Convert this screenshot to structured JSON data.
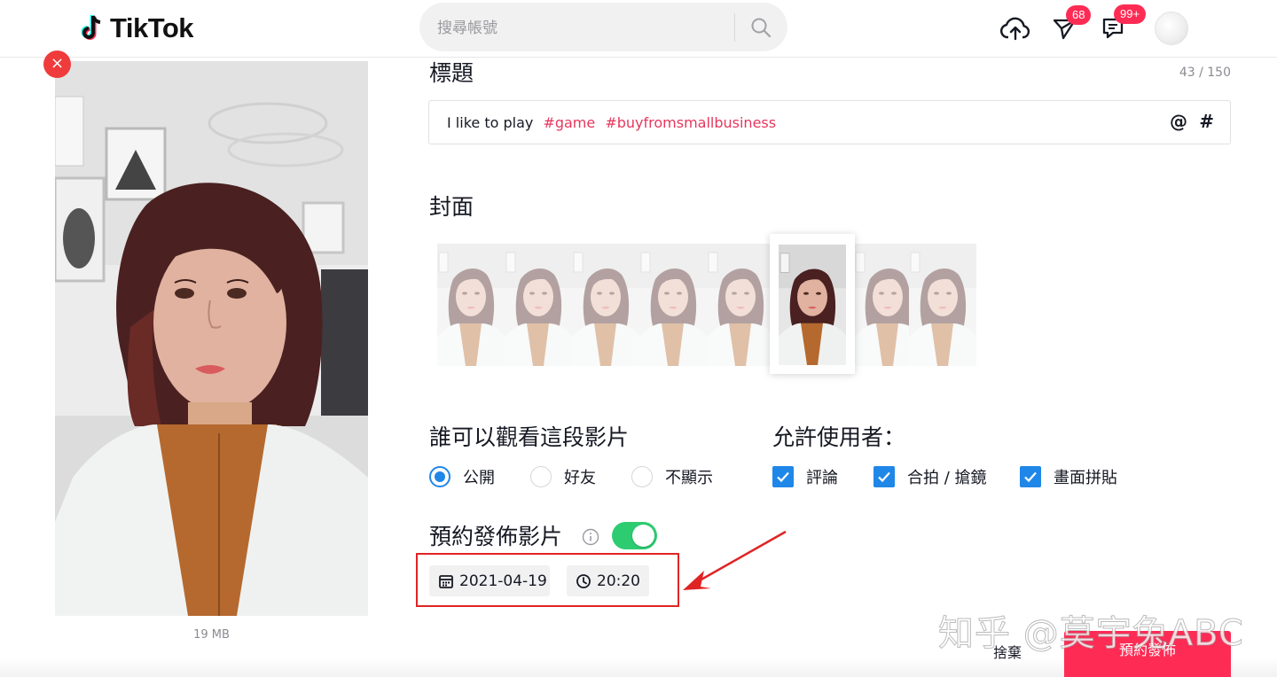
{
  "header": {
    "logo_text": "TikTok",
    "search_placeholder": "搜尋帳號",
    "inbox_badge": "68",
    "messages_badge": "99+"
  },
  "preview": {
    "file_size": "19 MB",
    "close_label": "×"
  },
  "caption": {
    "title": "標題",
    "char_count": "43 / 150",
    "text": "I like to play",
    "hashtags": [
      "#game",
      "#buyfromsmallbusiness"
    ],
    "mention_button": "@",
    "hashtag_button": "#"
  },
  "cover": {
    "title": "封面",
    "selected_frame": 6,
    "frame_count": 8
  },
  "privacy": {
    "title": "誰可以觀看這段影片",
    "options": [
      {
        "label": "公開",
        "selected": true
      },
      {
        "label": "好友",
        "selected": false
      },
      {
        "label": "不顯示",
        "selected": false
      }
    ]
  },
  "permissions": {
    "title": "允許使用者：",
    "items": [
      {
        "label": "評論",
        "checked": true
      },
      {
        "label": "合拍 / 搶鏡",
        "checked": true
      },
      {
        "label": "畫面拼貼",
        "checked": true
      }
    ]
  },
  "schedule": {
    "title": "預約發佈影片",
    "enabled": true,
    "date": "2021-04-19",
    "time": "20:20"
  },
  "actions": {
    "discard": "捨棄",
    "publish": "預約發佈"
  },
  "watermark": "知乎 @莫宇兔ABC",
  "colors": {
    "brand": "#fe2c55",
    "hashtag": "#e6375d",
    "selected_blue": "#1f87e8",
    "toggle_on": "#2ecc71",
    "annotation_red": "#e02424"
  }
}
